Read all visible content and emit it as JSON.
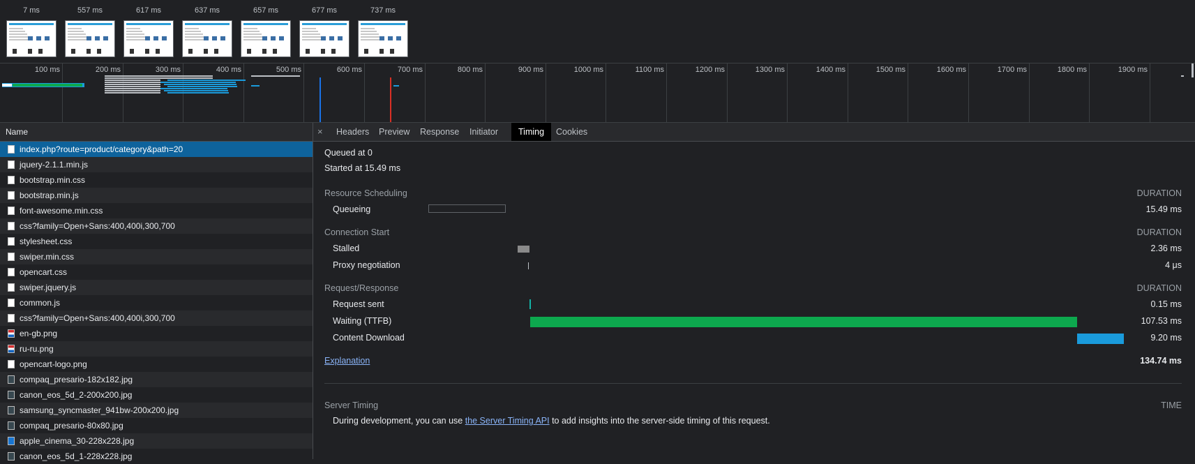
{
  "filmstrip": {
    "frames": [
      "7 ms",
      "557 ms",
      "617 ms",
      "637 ms",
      "657 ms",
      "677 ms",
      "737 ms"
    ]
  },
  "overview": {
    "ticks": [
      "100 ms",
      "200 ms",
      "300 ms",
      "400 ms",
      "500 ms",
      "600 ms",
      "700 ms",
      "800 ms",
      "900 ms",
      "1000 ms",
      "1100 ms",
      "1200 ms",
      "1300 ms",
      "1400 ms",
      "1500 ms",
      "1600 ms",
      "1700 ms",
      "1800 ms",
      "1900 ms",
      "200"
    ]
  },
  "requests": {
    "header": "Name",
    "items": [
      {
        "name": "index.php?route=product/category&path=20",
        "icon": "document-icon"
      },
      {
        "name": "jquery-2.1.1.min.js",
        "icon": "script-icon"
      },
      {
        "name": "bootstrap.min.css",
        "icon": "stylesheet-icon"
      },
      {
        "name": "bootstrap.min.js",
        "icon": "script-icon"
      },
      {
        "name": "font-awesome.min.css",
        "icon": "stylesheet-icon"
      },
      {
        "name": "css?family=Open+Sans:400,400i,300,700",
        "icon": "stylesheet-icon"
      },
      {
        "name": "stylesheet.css",
        "icon": "stylesheet-icon"
      },
      {
        "name": "swiper.min.css",
        "icon": "stylesheet-icon"
      },
      {
        "name": "opencart.css",
        "icon": "stylesheet-icon"
      },
      {
        "name": "swiper.jquery.js",
        "icon": "script-icon"
      },
      {
        "name": "common.js",
        "icon": "script-icon"
      },
      {
        "name": "css?family=Open+Sans:400,400i,300,700",
        "icon": "stylesheet-icon"
      },
      {
        "name": "en-gb.png",
        "icon": "flag-image-icon"
      },
      {
        "name": "ru-ru.png",
        "icon": "flag-image-icon"
      },
      {
        "name": "opencart-logo.png",
        "icon": "image-icon"
      },
      {
        "name": "compaq_presario-182x182.jpg",
        "icon": "image-icon"
      },
      {
        "name": "canon_eos_5d_2-200x200.jpg",
        "icon": "image-icon"
      },
      {
        "name": "samsung_syncmaster_941bw-200x200.jpg",
        "icon": "image-icon"
      },
      {
        "name": "compaq_presario-80x80.jpg",
        "icon": "image-icon"
      },
      {
        "name": "apple_cinema_30-228x228.jpg",
        "icon": "image-icon"
      },
      {
        "name": "canon_eos_5d_1-228x228.jpg",
        "icon": "image-icon"
      }
    ]
  },
  "tabs": {
    "close": "×",
    "items": [
      "Headers",
      "Preview",
      "Response",
      "Initiator",
      "Timing",
      "Cookies"
    ],
    "active": "Timing"
  },
  "timing": {
    "queued": "Queued at 0",
    "started": "Started at 15.49 ms",
    "duration_label": "DURATION",
    "resource_scheduling": {
      "title": "Resource Scheduling",
      "queueing": {
        "label": "Queueing",
        "value": "15.49 ms"
      }
    },
    "connection_start": {
      "title": "Connection Start",
      "stalled": {
        "label": "Stalled",
        "value": "2.36 ms"
      },
      "proxy": {
        "label": "Proxy negotiation",
        "value": "4 μs"
      }
    },
    "request_response": {
      "title": "Request/Response",
      "sent": {
        "label": "Request sent",
        "value": "0.15 ms"
      },
      "waiting": {
        "label": "Waiting (TTFB)",
        "value": "107.53 ms"
      },
      "download": {
        "label": "Content Download",
        "value": "9.20 ms"
      }
    },
    "explanation": "Explanation",
    "total": "134.74 ms",
    "server_timing": {
      "title": "Server Timing",
      "time_label": "TIME",
      "text_before": "During development, you can use ",
      "link": "the Server Timing API",
      "text_after": " to add insights into the server-side timing of this request."
    },
    "colors": {
      "waiting": "#0da84e",
      "download": "#1a9bdc",
      "stalled": "#8a8a8a"
    }
  }
}
